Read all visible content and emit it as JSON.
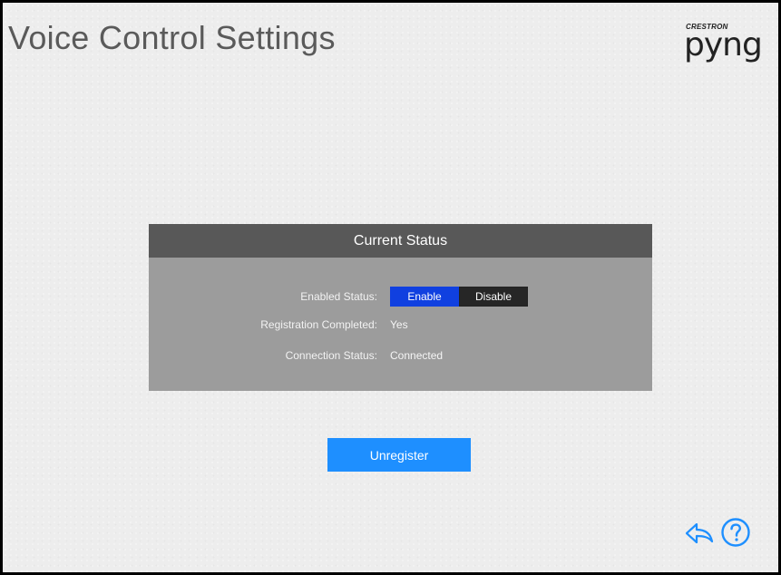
{
  "page": {
    "title": "Voice Control Settings"
  },
  "logo": {
    "top_text": "CRESTRON",
    "main_text": "pyng"
  },
  "status_panel": {
    "header": "Current Status",
    "enabled": {
      "label": "Enabled Status:",
      "enable_label": "Enable",
      "disable_label": "Disable",
      "selected": "Enable"
    },
    "registration": {
      "label": "Registration Completed:",
      "value": "Yes"
    },
    "connection": {
      "label": "Connection Status:",
      "value": "Connected"
    }
  },
  "actions": {
    "unregister_label": "Unregister"
  },
  "footer": {
    "back_icon": "back-arrow-icon",
    "help_icon": "help-icon"
  },
  "colors": {
    "accent": "#1e8fff",
    "toggle_selected": "#1040e0",
    "toggle_unselected": "#262626",
    "panel_header": "#585858",
    "panel_body": "#9c9c9c"
  }
}
